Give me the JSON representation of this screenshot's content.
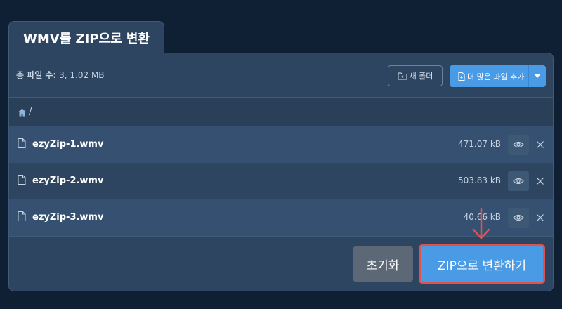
{
  "tab": {
    "title": "WMV를 ZIP으로 변환"
  },
  "toolbar": {
    "total_label": "총 파일 수:",
    "total_value": "3, 1.02 MB",
    "new_folder_label": "새 폴더",
    "add_more_label": "더 많은 파일 추가"
  },
  "breadcrumb": {
    "path": "/"
  },
  "files": [
    {
      "name": "ezyZip-1.wmv",
      "size": "471.07 kB"
    },
    {
      "name": "ezyZip-2.wmv",
      "size": "503.83 kB"
    },
    {
      "name": "ezyZip-3.wmv",
      "size": "40.66 kB"
    }
  ],
  "footer": {
    "reset_label": "초기화",
    "convert_label": "ZIP으로 변환하기"
  },
  "colors": {
    "background": "#0f2035",
    "panel": "#2d4560",
    "accent": "#4a9be6",
    "highlight": "#e0524f"
  }
}
